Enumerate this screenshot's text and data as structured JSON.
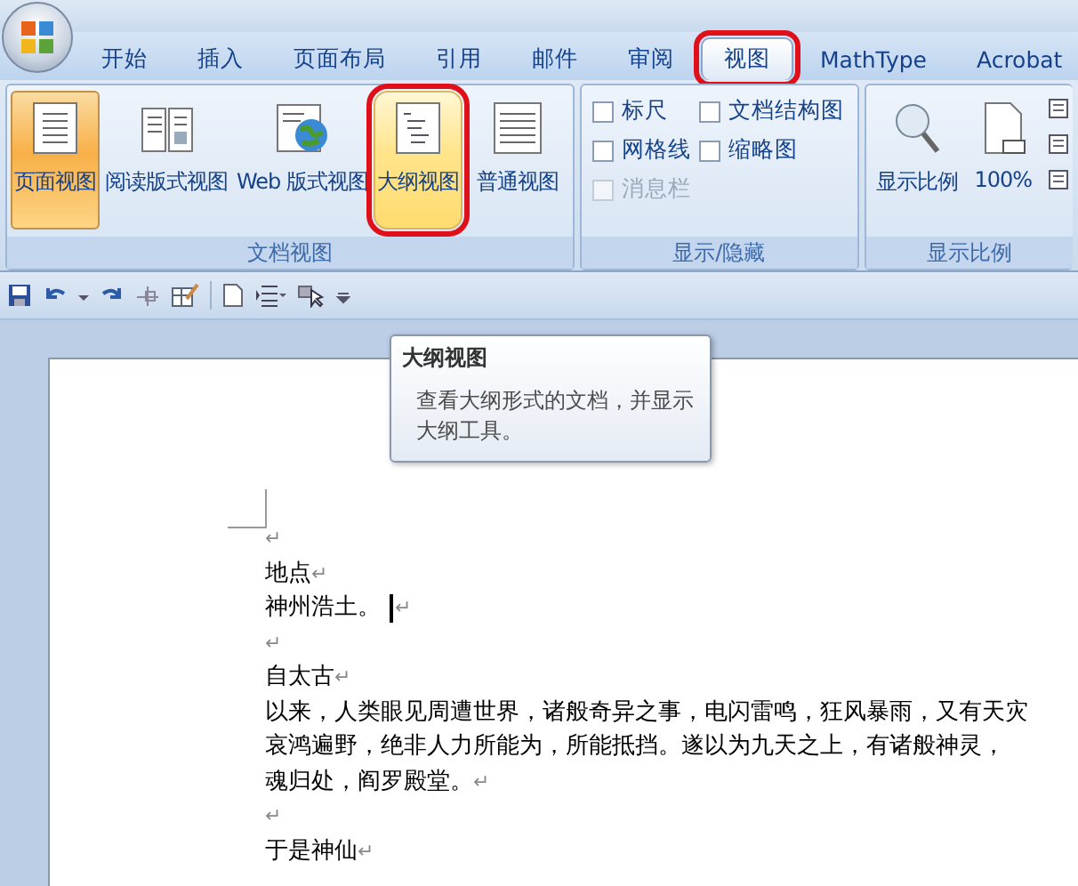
{
  "tabs": [
    {
      "label": "开始",
      "selected": false,
      "highlighted": false
    },
    {
      "label": "插入",
      "selected": false,
      "highlighted": false
    },
    {
      "label": "页面布局",
      "selected": false,
      "highlighted": false
    },
    {
      "label": "引用",
      "selected": false,
      "highlighted": false
    },
    {
      "label": "邮件",
      "selected": false,
      "highlighted": false
    },
    {
      "label": "审阅",
      "selected": false,
      "highlighted": false
    },
    {
      "label": "视图",
      "selected": true,
      "highlighted": true
    },
    {
      "label": "MathType",
      "selected": false,
      "highlighted": false
    },
    {
      "label": "Acrobat",
      "selected": false,
      "highlighted": false
    }
  ],
  "ribbon": {
    "groups": [
      {
        "kind": "views",
        "label": "文档视图",
        "buttons": [
          {
            "label": "页面视图",
            "selected": true,
            "hovered": false,
            "highlighted": false,
            "kind": "page"
          },
          {
            "label": "阅读版式视图",
            "selected": false,
            "hovered": false,
            "highlighted": false,
            "kind": "book"
          },
          {
            "label": "Web 版式视图",
            "selected": false,
            "hovered": false,
            "highlighted": false,
            "kind": "web"
          },
          {
            "label": "大纲视图",
            "selected": false,
            "hovered": true,
            "highlighted": true,
            "kind": "outline"
          },
          {
            "label": "普通视图",
            "selected": false,
            "hovered": false,
            "highlighted": false,
            "kind": "draft"
          }
        ]
      },
      {
        "kind": "checks",
        "label": "显示/隐藏",
        "items": [
          {
            "label": "标尺",
            "checked": false,
            "disabled": false
          },
          {
            "label": "文档结构图",
            "checked": false,
            "disabled": false
          },
          {
            "label": "网格线",
            "checked": false,
            "disabled": false
          },
          {
            "label": "缩略图",
            "checked": false,
            "disabled": false
          },
          {
            "label": "消息栏",
            "checked": false,
            "disabled": true
          }
        ]
      },
      {
        "kind": "zoom",
        "label": "显示比例",
        "buttons": [
          {
            "label": "显示比例",
            "kind": "magnifier"
          },
          {
            "label": "100%",
            "kind": "page100"
          }
        ]
      }
    ]
  },
  "tooltip": {
    "title": "大纲视图",
    "text": "查看大纲形式的文档，并显示大纲工具。"
  },
  "document": {
    "lines": [
      {
        "mark": "↵"
      },
      {
        "text": "地点",
        "mark": "↵"
      },
      {
        "text": "神州浩土。",
        "mark": "↵",
        "cursor": true
      },
      {
        "mark": "↵"
      },
      {
        "text": "自太古",
        "mark": "↵"
      },
      {
        "text": "以来，人类眼见周遭世界，诸般奇异之事，电闪雷鸣，狂风暴雨，又有天灾"
      },
      {
        "text": "哀鸿遍野，绝非人力所能为，所能抵挡。遂以为九天之上，有诸般神灵，"
      },
      {
        "text": "魂归处，阎罗殿堂。",
        "mark": "↵"
      },
      {
        "mark": "↵"
      },
      {
        "text": "于是神仙",
        "mark": "↵"
      }
    ]
  }
}
